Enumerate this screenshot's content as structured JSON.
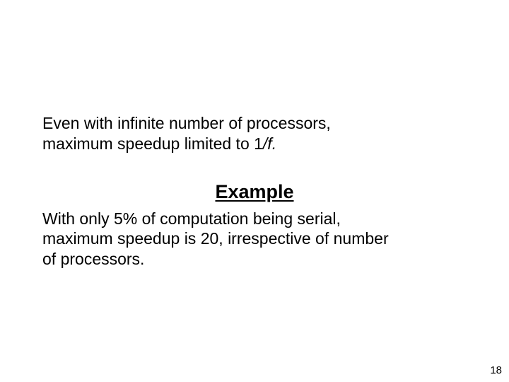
{
  "intro": {
    "line1": "Even with infinite number of processors,",
    "line2a": "maximum speedup limited to 1",
    "line2b": "/f."
  },
  "heading": "Example",
  "example": {
    "line1": "With only 5% of computation being serial,",
    "line2": "maximum speedup is 20, irrespective of number",
    "line3": "of processors."
  },
  "pageNumber": "18"
}
